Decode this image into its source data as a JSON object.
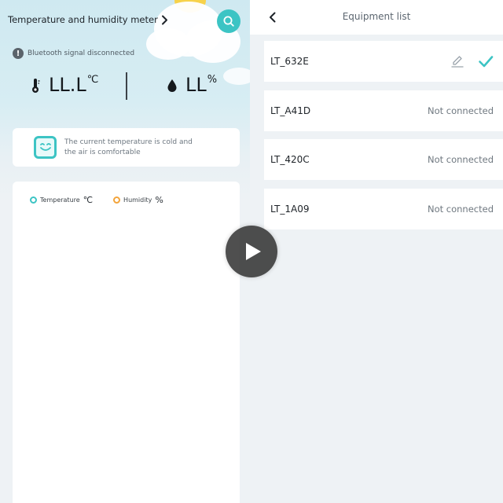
{
  "left_panel": {
    "app_title": "Temperature and humidity meter",
    "bluetooth_status": "Bluetooth signal disconnected",
    "temperature": {
      "value": "LL.L",
      "unit": "℃"
    },
    "humidity": {
      "value": "LL",
      "unit": "%"
    },
    "status_message": "The current temperature is cold and the air is comfortable",
    "legend": [
      {
        "label": "Temperature",
        "unit": "℃",
        "color": "#3cc4c4"
      },
      {
        "label": "Humidity",
        "unit": "%",
        "color": "#f3a43a"
      }
    ]
  },
  "right_panel": {
    "title": "Equipment list",
    "devices": [
      {
        "name": "LT_632E",
        "status": ""
      },
      {
        "name": "LT_A41D",
        "status": "Not connected"
      },
      {
        "name": "LT_420C",
        "status": "Not connected"
      },
      {
        "name": "LT_1A09",
        "status": "Not connected"
      }
    ]
  },
  "icons": [
    "chevron-right-icon",
    "search-icon",
    "alert-icon",
    "thermometer-icon",
    "water-drop-icon",
    "smile-face-icon",
    "back-arrow-icon",
    "edit-icon",
    "checkmark-icon",
    "play-icon"
  ],
  "colors": {
    "accent": "#3cc4c4",
    "humidity": "#f3a43a"
  }
}
